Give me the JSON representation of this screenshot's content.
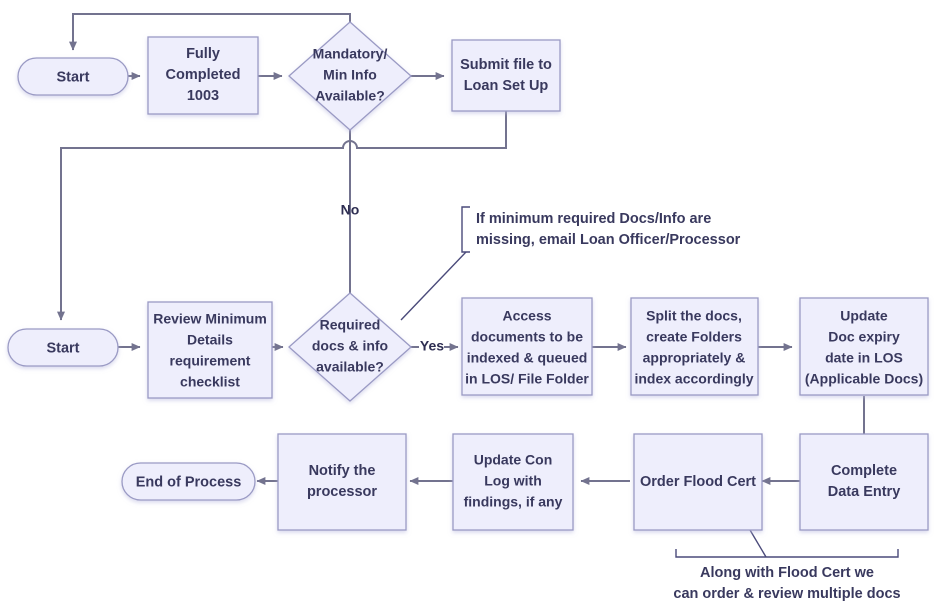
{
  "diagram": {
    "title": "Loan document intake and indexing process flowchart",
    "colors": {
      "node_fill": "#eeeefc",
      "node_stroke": "#9a9ac4",
      "connector": "#73738f",
      "text": "#39395e",
      "callout": "#4a4a7a",
      "background": "#ffffff"
    },
    "nodes": [
      {
        "id": "start1",
        "shape": "terminator",
        "lines": [
          "Start"
        ]
      },
      {
        "id": "fully_completed",
        "shape": "process",
        "lines": [
          "Fully",
          "Completed",
          "1003"
        ]
      },
      {
        "id": "mandatory_decision",
        "shape": "decision",
        "lines": [
          "Mandatory/",
          "Min Info",
          "Available?"
        ]
      },
      {
        "id": "submit_file",
        "shape": "process",
        "lines": [
          "Submit file to",
          "Loan Set Up"
        ]
      },
      {
        "id": "start2",
        "shape": "terminator",
        "lines": [
          "Start"
        ]
      },
      {
        "id": "review_checklist",
        "shape": "process",
        "lines": [
          "Review Minimum",
          "Details",
          "requirement",
          "checklist"
        ]
      },
      {
        "id": "required_decision",
        "shape": "decision",
        "lines": [
          "Required",
          "docs & info",
          "available?"
        ]
      },
      {
        "id": "access_documents",
        "shape": "process",
        "lines": [
          "Access",
          "documents to be",
          "indexed & queued",
          "in LOS/ File Folder"
        ]
      },
      {
        "id": "split_docs",
        "shape": "process",
        "lines": [
          "Split the docs,",
          "create Folders",
          "appropriately &",
          "index accordingly"
        ]
      },
      {
        "id": "update_expiry",
        "shape": "process",
        "lines": [
          "Update",
          "Doc expiry",
          "date in LOS",
          "(Applicable Docs)"
        ]
      },
      {
        "id": "complete_data_entry",
        "shape": "process",
        "lines": [
          "Complete",
          "Data Entry"
        ]
      },
      {
        "id": "order_flood_cert",
        "shape": "process",
        "lines": [
          "Order Flood Cert"
        ]
      },
      {
        "id": "update_con_log",
        "shape": "process",
        "lines": [
          "Update Con",
          "Log with",
          "findings, if any"
        ]
      },
      {
        "id": "notify_processor",
        "shape": "process",
        "lines": [
          "Notify the",
          "processor"
        ]
      },
      {
        "id": "end_of_process",
        "shape": "terminator",
        "lines": [
          "End of Process"
        ]
      }
    ],
    "edge_labels": [
      {
        "id": "no_label",
        "text": "No"
      },
      {
        "id": "yes_label",
        "text": "Yes"
      }
    ],
    "callouts": [
      {
        "id": "missing_docs_note",
        "lines": [
          "If minimum required Docs/Info are",
          "missing, email Loan Officer/Processor"
        ]
      },
      {
        "id": "flood_cert_note",
        "lines": [
          "Along with Flood Cert we",
          "can order & review multiple docs"
        ]
      }
    ]
  }
}
